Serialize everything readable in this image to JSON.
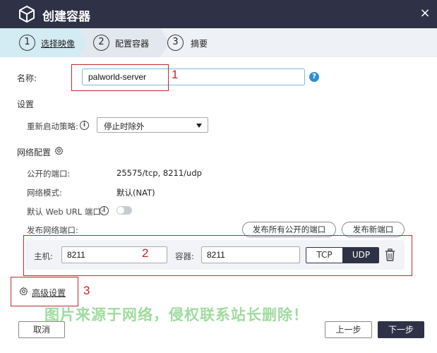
{
  "window": {
    "title": "创建容器"
  },
  "steps": [
    {
      "num": "1",
      "label": "选择映像"
    },
    {
      "num": "2",
      "label": "配置容器"
    },
    {
      "num": "3",
      "label": "摘要"
    }
  ],
  "name": {
    "label": "名称:",
    "value": "palworld-server",
    "help": "?"
  },
  "settings": {
    "header": "设置",
    "restart_label": "重新启动策略:",
    "restart_value": "停止时除外"
  },
  "network": {
    "header": "网络配置",
    "public_ports_label": "公开的端口:",
    "public_ports_value": "25575/tcp, 8211/udp",
    "mode_label": "网络模式:",
    "mode_value": "默认(NAT)",
    "weburl_label": "默认 Web URL 端口:",
    "weburl_toggle": false,
    "publish_label": "发布网络端口:",
    "publish_all_button": "发布所有公开的端口",
    "publish_new_button": "发布新端口",
    "port_row": {
      "host_label": "主机:",
      "host_value": "8211",
      "container_label": "容器:",
      "container_value": "8211",
      "protocol_tcp": "TCP",
      "protocol_udp": "UDP",
      "selected_protocol": "UDP"
    }
  },
  "advanced_link": "高级设置",
  "annotations": [
    "1",
    "2",
    "3"
  ],
  "watermark": "图片来源于网络，侵权联系站长删除！",
  "footer": {
    "cancel": "取消",
    "prev": "上一步",
    "next": "下一步"
  },
  "colors": {
    "titlebar": "#2f3246",
    "annotation": "#c0282b",
    "accent": "#2f8fd6",
    "watermark": "#7fd07f"
  }
}
